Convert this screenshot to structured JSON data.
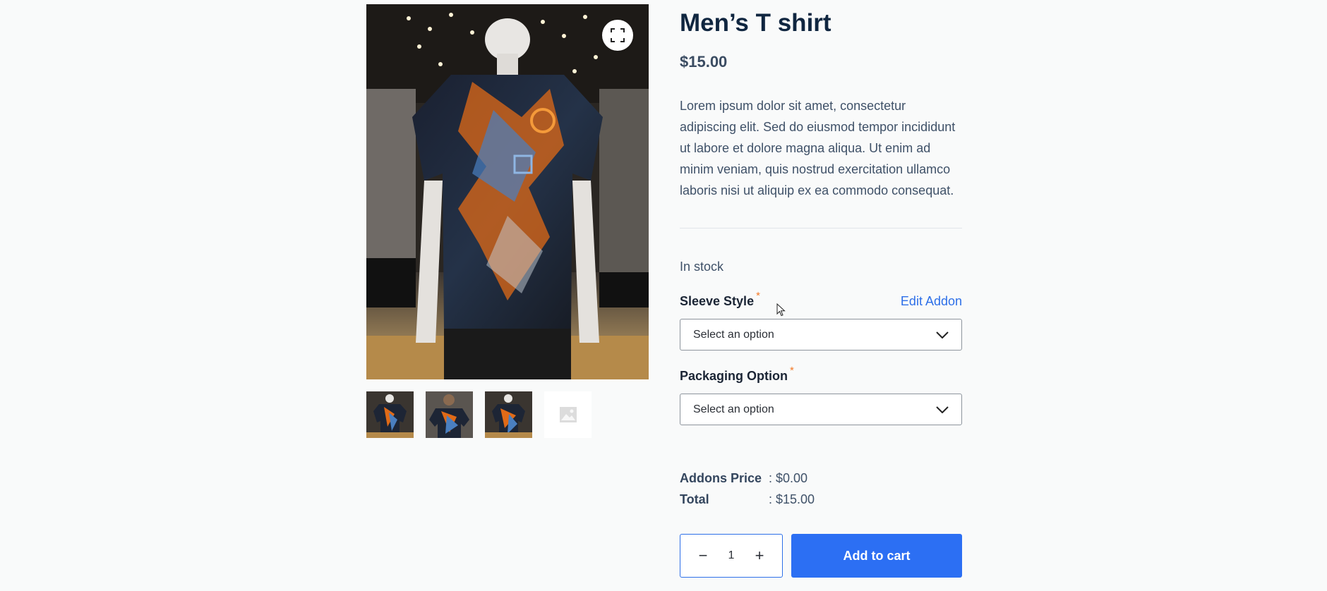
{
  "gallery": {
    "main_image_alt": "Men's T shirt on mannequin",
    "zoom_icon": "fullscreen-icon",
    "thumbnails": [
      "thumb-front",
      "thumb-model",
      "thumb-mannequin"
    ],
    "placeholder_icon": "image-placeholder-icon"
  },
  "product": {
    "title": "Men’s T shirt",
    "price": "$15.00",
    "description": "Lorem ipsum dolor sit amet, consectetur adipiscing elit. Sed do eiusmod tempor incididunt ut labore et dolore magna aliqua. Ut enim ad minim veniam, quis nostrud exercitation ullamco laboris nisi ut aliquip ex ea commodo consequat.",
    "stock": "In stock"
  },
  "addons": {
    "edit_label": "Edit Addon",
    "required_mark": "*",
    "fields": [
      {
        "label": "Sleeve Style",
        "selected": "Select an option"
      },
      {
        "label": "Packaging Option",
        "selected": "Select an option"
      }
    ]
  },
  "totals": {
    "addons_price_label": "Addons Price",
    "addons_price_value": ": $0.00",
    "total_label": "Total",
    "total_value": ": $15.00"
  },
  "cart": {
    "minus": "−",
    "quantity": "1",
    "plus": "+",
    "add_label": "Add to cart"
  },
  "colors": {
    "accent": "#2c6ff3",
    "required": "#f37a28",
    "title": "#102640"
  }
}
